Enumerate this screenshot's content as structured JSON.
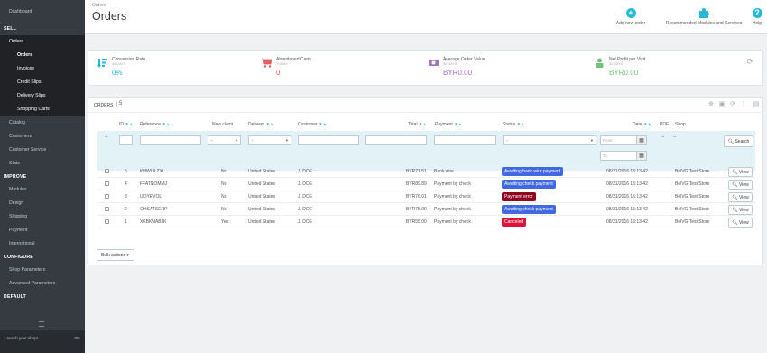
{
  "sidebar": {
    "dashboard": "Dashboard",
    "sell_section": "SELL",
    "orders": "Orders",
    "orders_sub": [
      "Orders",
      "Invoices",
      "Credit Slips",
      "Delivery Slips",
      "Shopping Carts"
    ],
    "sell_items": [
      "Catalog",
      "Customers",
      "Customer Service",
      "Stats"
    ],
    "improve_section": "IMPROVE",
    "improve_items": [
      "Modules",
      "Design",
      "Shipping",
      "Payment",
      "International"
    ],
    "configure_section": "CONFIGURE",
    "configure_items": [
      "Shop Parameters",
      "Advanced Parameters"
    ],
    "default_section": "DEFAULT",
    "search_label": "Launch your shop!",
    "progress_text": "0%"
  },
  "header": {
    "breadcrumb": "Orders",
    "title": "Orders",
    "add_new_order": "Add new order",
    "recommended": "Recommended Modules and Services",
    "help": "Help"
  },
  "kpis": [
    {
      "title": "Conversion Rate",
      "sub": "30 DAYS",
      "value": "0%",
      "color": "#25b9d7"
    },
    {
      "title": "Abandoned Carts",
      "sub": "TODAY",
      "value": "0",
      "color": "#e15f5f"
    },
    {
      "title": "Average Order Value",
      "sub": "30 DAYS",
      "value": "BYR0.00",
      "color": "#a075b9"
    },
    {
      "title": "Net Profit per Visit",
      "sub": "30 DAYS",
      "value": "BYR0.00",
      "color": "#72c279"
    }
  ],
  "orders_panel": {
    "title": "ORDERS",
    "count": "5",
    "columns": {
      "id": "ID",
      "reference": "Reference",
      "new_client": "New client",
      "delivery": "Delivery",
      "customer": "Customer",
      "total": "Total",
      "payment": "Payment",
      "status": "Status",
      "date": "Date",
      "pdf": "PDF",
      "shop": "Shop"
    },
    "filter": {
      "dash": "--",
      "select_dash": "-",
      "from_placeholder": "From",
      "to_placeholder": "To",
      "search_label": "Search"
    },
    "rows": [
      {
        "id": "5",
        "reference": "KHWLILZXL",
        "new_client": "No",
        "delivery": "United States",
        "customer": "J. DOE",
        "total": "BYR71.51",
        "payment": "Bank wire",
        "status": "Awaiting bank wire payment",
        "status_color": "#4169e1",
        "date": "08/31/2016 15:13:42",
        "shop": "BelVG Test Store",
        "view": "View"
      },
      {
        "id": "4",
        "reference": "FFATNOMMJ",
        "new_client": "No",
        "delivery": "United States",
        "customer": "J. DOE",
        "total": "BYR89.89",
        "payment": "Payment by check",
        "status": "Awaiting check payment",
        "status_color": "#4169e1",
        "date": "08/31/2016 15:13:42",
        "shop": "BelVG Test Store",
        "view": "View"
      },
      {
        "id": "3",
        "reference": "UOYEVOLI",
        "new_client": "No",
        "delivery": "United States",
        "customer": "J. DOE",
        "total": "BYR76.01",
        "payment": "Payment by check",
        "status": "Payment error",
        "status_color": "#8f0621",
        "date": "08/31/2016 15:13:42",
        "shop": "BelVG Test Store",
        "view": "View"
      },
      {
        "id": "2",
        "reference": "OHSATSERP",
        "new_client": "No",
        "delivery": "United States",
        "customer": "J. DOE",
        "total": "BYR75.90",
        "payment": "Payment by check",
        "status": "Awaiting check payment",
        "status_color": "#4169e1",
        "date": "08/31/2016 15:13:42",
        "shop": "BelVG Test Store",
        "view": "View"
      },
      {
        "id": "1",
        "reference": "XKBKNABJK",
        "new_client": "Yes",
        "delivery": "United States",
        "customer": "J. DOE",
        "total": "BYR55.00",
        "payment": "Payment by check",
        "status": "Canceled",
        "status_color": "#dc143c",
        "date": "08/31/2016 15:13:42",
        "shop": "BelVG Test Store",
        "view": "View"
      }
    ],
    "bulk_actions": "Bulk actions"
  }
}
